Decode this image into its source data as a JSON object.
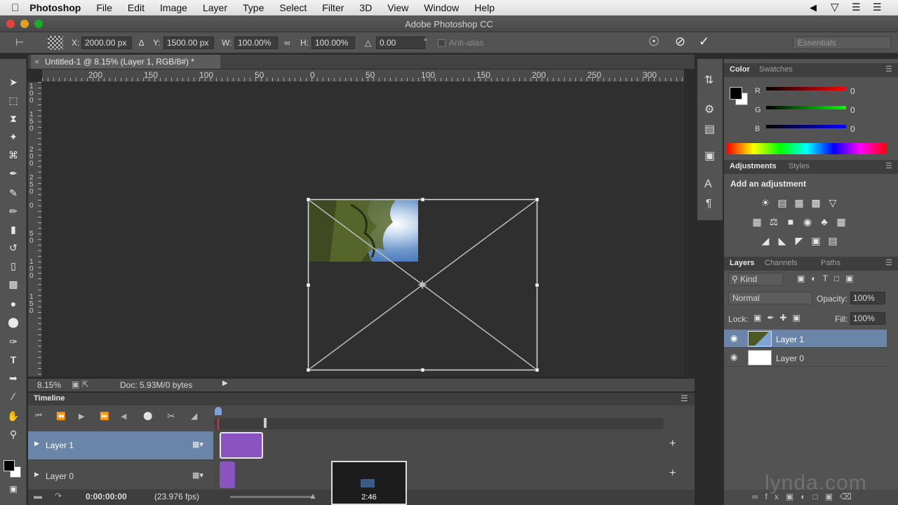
{
  "menubar": {
    "app": "Photoshop",
    "items": [
      "File",
      "Edit",
      "Image",
      "Layer",
      "Type",
      "Select",
      "Filter",
      "3D",
      "View",
      "Window",
      "Help"
    ]
  },
  "window": {
    "title": "Adobe Photoshop CC"
  },
  "options": {
    "x_label": "X:",
    "x_value": "2000.00 px",
    "y_label": "Y:",
    "y_value": "1500.00 px",
    "w_label": "W:",
    "w_value": "100.00%",
    "h_label": "H:",
    "h_value": "100.00%",
    "angle_value": "0.00",
    "deg": "°",
    "antialias": "Anti-alias",
    "workspace": "Essentials"
  },
  "document": {
    "tab_title": "Untitled-1 @ 8.15% (Layer 1, RGB/8#) *",
    "ruler_h": [
      "200",
      "150",
      "100",
      "50",
      "0",
      "50",
      "100",
      "150",
      "200",
      "250",
      "300"
    ],
    "ruler_v": [
      "1\n0\n0",
      "1\n5\n0",
      "2\n0\n0",
      "2\n5\n0",
      "0",
      "5\n0",
      "1\n0\n0",
      "1\n5\n0"
    ],
    "zoom": "8.15%",
    "doc_info": "Doc: 5.93M/0 bytes"
  },
  "timeline": {
    "title": "Timeline",
    "tracks": [
      {
        "label": "Layer 1"
      },
      {
        "label": "Layer 0"
      }
    ],
    "timecode": "0:00:00:00",
    "fps": "(23.976 fps)"
  },
  "color_panel": {
    "tabs": [
      "Color",
      "Swatches"
    ],
    "r_label": "R",
    "g_label": "G",
    "b_label": "B",
    "r": "0",
    "g": "0",
    "b": "0"
  },
  "adjustments_panel": {
    "tabs": [
      "Adjustments",
      "Styles"
    ],
    "heading": "Add an adjustment"
  },
  "layers_panel": {
    "tabs": [
      "Layers",
      "Channels",
      "Paths"
    ],
    "kind": "Kind",
    "blend_mode": "Normal",
    "opacity_label": "Opacity:",
    "opacity": "100%",
    "lock_label": "Lock:",
    "fill_label": "Fill:",
    "fill": "100%",
    "layers": [
      {
        "name": "Layer 1",
        "selected": true
      },
      {
        "name": "Layer 0",
        "selected": false
      }
    ]
  },
  "video_thumb": {
    "time": "2:46"
  },
  "watermark": "lynda.com",
  "colors": {
    "accent_selected": "#6b85a8",
    "clip_purple": "#8a54c0",
    "app_bg": "#2b2b2b"
  }
}
